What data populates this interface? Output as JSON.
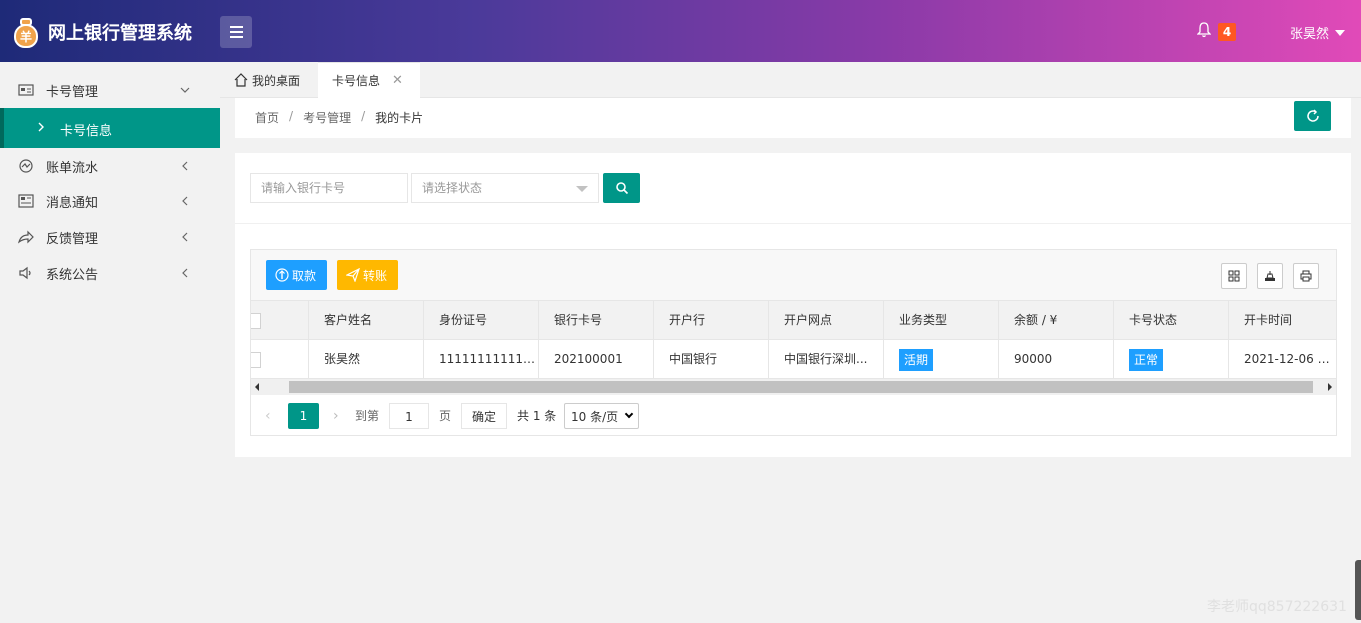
{
  "header": {
    "logo_glyph": "羊",
    "title": "网上银行管理系统",
    "notification_count": "4",
    "user_name": "张昊然"
  },
  "sidebar": {
    "items": [
      {
        "label": "卡号管理",
        "icon": "card-icon",
        "arrow": "chevron-down-icon"
      },
      {
        "label": "账单流水",
        "icon": "chart-icon",
        "arrow": "chevron-left-icon"
      },
      {
        "label": "消息通知",
        "icon": "message-icon",
        "arrow": "chevron-left-icon"
      },
      {
        "label": "反馈管理",
        "icon": "share-icon",
        "arrow": "chevron-left-icon"
      },
      {
        "label": "系统公告",
        "icon": "speaker-icon",
        "arrow": "chevron-left-icon"
      }
    ],
    "active_sub": "卡号信息"
  },
  "tabs": [
    {
      "label": "我的桌面",
      "icon": "home-icon"
    },
    {
      "label": "卡号信息",
      "closable": true
    }
  ],
  "breadcrumb": [
    "首页",
    "考号管理",
    "我的卡片"
  ],
  "search": {
    "card_placeholder": "请输入银行卡号",
    "status_placeholder": "请选择状态"
  },
  "toolbar": {
    "withdraw_label": "取款",
    "transfer_label": "转账"
  },
  "table": {
    "columns": [
      "客户姓名",
      "身份证号",
      "银行卡号",
      "开户行",
      "开户网点",
      "业务类型",
      "余额 / ¥",
      "卡号状态",
      "开卡时间"
    ],
    "rows": [
      {
        "name": "张昊然",
        "id_number": "111111111111...",
        "card_number": "202100001",
        "bank": "中国银行",
        "branch": "中国银行深圳...",
        "business_type": "活期",
        "balance": "90000",
        "status": "正常",
        "open_time": "2021-12-06 1..."
      }
    ]
  },
  "pager": {
    "current_page": "1",
    "goto_label": "到第",
    "goto_value": "1",
    "page_label": "页",
    "confirm_label": "确定",
    "total_label": "共 1 条",
    "page_size": "10 条/页"
  },
  "watermark": "李老师qq857222631",
  "colors": {
    "primary": "#009688",
    "blue": "#1e9fff",
    "orange": "#ffb800",
    "badge": "#ff5722"
  }
}
